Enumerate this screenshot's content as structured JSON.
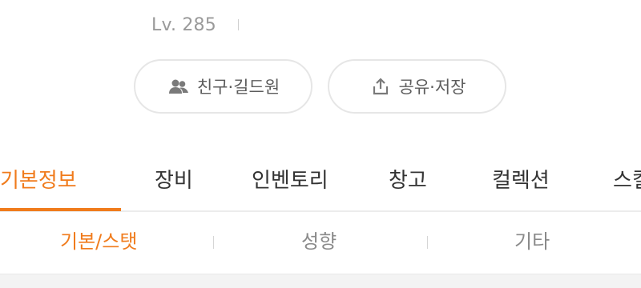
{
  "profile": {
    "level": "Lv. 285"
  },
  "actions": {
    "friends_label": "친구·길드원",
    "friends_icon": "people-icon",
    "share_label": "공유·저장",
    "share_icon": "share-upload-icon"
  },
  "tabs": [
    {
      "label": "기본정보",
      "active": true
    },
    {
      "label": "장비",
      "active": false
    },
    {
      "label": "인벤토리",
      "active": false
    },
    {
      "label": "창고",
      "active": false
    },
    {
      "label": "컬렉션",
      "active": false
    },
    {
      "label": "스킬",
      "active": false
    }
  ],
  "subtabs": [
    {
      "label": "기본/스탯",
      "active": true
    },
    {
      "label": "성향",
      "active": false
    },
    {
      "label": "기타",
      "active": false
    }
  ],
  "colors": {
    "accent": "#f07b1c",
    "text": "#333333",
    "muted": "#9a9a9a"
  }
}
